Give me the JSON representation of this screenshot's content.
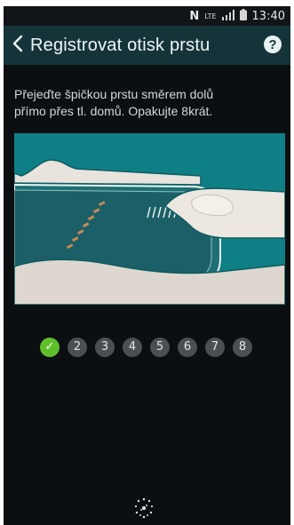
{
  "status_bar": {
    "time": "13:40",
    "lte_label": "LTE",
    "icons": [
      "nfc-icon",
      "lte-icon",
      "signal-icon",
      "battery-icon"
    ]
  },
  "header": {
    "title": "Registrovat otisk prstu",
    "back_icon": "chevron-left-icon",
    "help_icon": "help-icon",
    "help_glyph": "?"
  },
  "instruction": {
    "line1": "Přejeďte špičkou prstu směrem dolů",
    "line2": "přímo přes tl. domů. Opakujte 8krát."
  },
  "progress": {
    "steps": [
      {
        "label": "✓",
        "done": true
      },
      {
        "label": "2",
        "done": false
      },
      {
        "label": "3",
        "done": false
      },
      {
        "label": "4",
        "done": false
      },
      {
        "label": "5",
        "done": false
      },
      {
        "label": "6",
        "done": false
      },
      {
        "label": "7",
        "done": false
      },
      {
        "label": "8",
        "done": false
      }
    ],
    "completed": 1,
    "total": 8
  },
  "colors": {
    "appbar": "#14343a",
    "background": "#0b0f12",
    "illustration": "#0f7f86",
    "step_done": "#5fbf2b",
    "step_pending": "#4b4f53"
  }
}
